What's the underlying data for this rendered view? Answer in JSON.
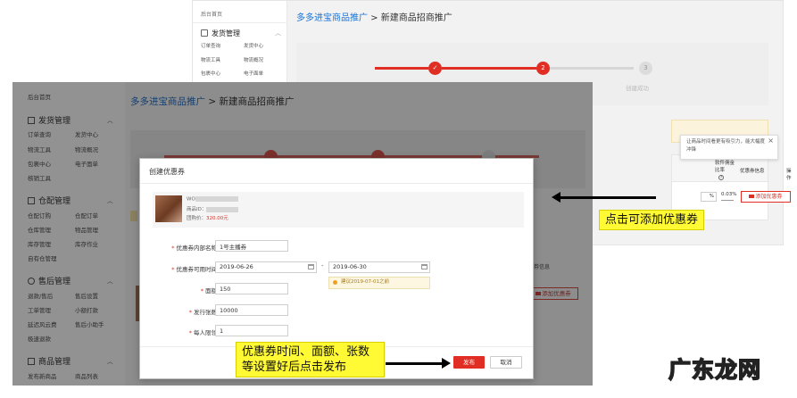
{
  "back": {
    "sidebar": {
      "home": "后台首页",
      "section_title": "发货管理",
      "items": [
        "订单查询",
        "发货中心",
        "物流工具",
        "物流概况",
        "包裹中心",
        "电子面单"
      ]
    },
    "breadcrumb_link": "多多进宝商品推广",
    "breadcrumb_sep": " > ",
    "breadcrumb_current": "新建商品招商推广",
    "steps": [
      "✓",
      "2",
      "3"
    ],
    "step_label_3": "创建成功",
    "tooltip_close": "×",
    "tooltip_text": "让商品时间看更有吸引力，能大幅度冲锋",
    "table_headers": [
      "软件佣金比率",
      "优惠券信息",
      "操作"
    ],
    "rate_value": "0.03%",
    "percent_unit": "%",
    "add_coupon_button": "添加优惠券"
  },
  "front": {
    "sidebar": {
      "home": "后台首页",
      "sections": [
        {
          "title": "发货管理",
          "items": [
            "订单查询",
            "发货中心",
            "物流工具",
            "物流概况",
            "包裹中心",
            "电子面单",
            "核销工具"
          ]
        },
        {
          "title": "仓配管理",
          "items": [
            "仓配订购",
            "仓配订单",
            "仓库管理",
            "物品管理",
            "库存管理",
            "库存作业",
            "自有仓管理"
          ]
        },
        {
          "title": "售后管理",
          "items": [
            "退款/售后",
            "售后设置",
            "工单管理",
            "小额打款",
            "延迟风云费",
            "售后小助手",
            "极速退款"
          ]
        },
        {
          "title": "商品管理",
          "items": [
            "发布新商品",
            "商品列表"
          ]
        }
      ]
    },
    "breadcrumb_link": "多多进宝商品推广",
    "breadcrumb_sep": " > ",
    "breadcrumb_current": "新建商品招商推广",
    "coupon_info_header": "券信息",
    "add_coupon_button": "添加优惠券"
  },
  "dialog": {
    "title": "创建优惠券",
    "product": {
      "name_prefix": "WO",
      "meta_prefix": "商品ID：",
      "price_label": "团购价：",
      "price": "320.00元"
    },
    "fields": {
      "name_label": "优惠券内部名称",
      "name_value": "1号主播券",
      "period_label": "优惠券可用时间",
      "start_date": "2019-06-26",
      "date_sep": "-",
      "end_date": "2019-06-30",
      "date_hint": "建议2019-07-01之前",
      "amount_label": "面额",
      "amount_value": "150",
      "count_label": "发行张数",
      "count_value": "10000",
      "limit_label": "每人限领",
      "limit_value": "1"
    },
    "publish_button": "发布",
    "cancel_button": "取消"
  },
  "callouts": {
    "add_coupon": "点击可添加优惠券",
    "publish_line1": "优惠券时间、面额、张数",
    "publish_line2": "等设置好后点击发布"
  },
  "watermark": "广东龙网",
  "colors": {
    "accent_red": "#e02e24",
    "link_blue": "#1b74d8",
    "callout_yellow": "#fffa33"
  }
}
